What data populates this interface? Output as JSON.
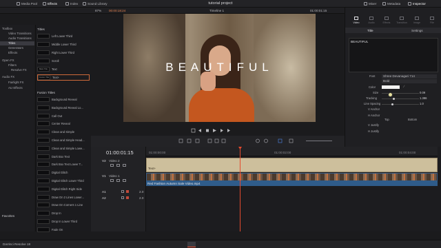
{
  "topbar": {
    "title": "tutorial project",
    "tabs_left": [
      "Media Pool",
      "Effects",
      "Index",
      "Sound Library"
    ],
    "tabs_right": [
      "Mixer",
      "Metadata",
      "Inspector"
    ]
  },
  "viewer": {
    "zoom": "87%",
    "timecode_in": "00:00:18:24",
    "timeline_name": "Timeline 1",
    "timecode": "01:00:01:15",
    "overlay_text": "BEAUTIFUL"
  },
  "toolbox": {
    "items": [
      "Toolbox",
      "Video Transitions",
      "Audio Transitions",
      "Titles",
      "Generators",
      "Effects",
      "Open FX",
      "Filters",
      "Resolve FX",
      "Audio FX",
      "Fairlight FX",
      "AU Effects"
    ],
    "favorites_label": "Favorites"
  },
  "effects": {
    "titles_header": "Titles",
    "titles": [
      {
        "name": "Left Lower Third",
        "thumb": ""
      },
      {
        "name": "Middle Lower Third",
        "thumb": ""
      },
      {
        "name": "Right Lower Third",
        "thumb": ""
      },
      {
        "name": "Scroll",
        "thumb": ""
      },
      {
        "name": "Text",
        "thumb": "Basic Title"
      },
      {
        "name": "Text+",
        "thumb": "Custom Title"
      }
    ],
    "fusion_header": "Fusion Titles",
    "fusion_titles": [
      "Background Reveal",
      "Background Reveal Lo...",
      "Call Out",
      "Center Reveal",
      "Clean and Simple",
      "Clean and Simple Head...",
      "Clean and Simple Lowe...",
      "Dark Box Text",
      "Dark Box Text Lower T...",
      "Digital Glitch",
      "Digital Glitch Lower Third",
      "Digital Glitch Right Side",
      "Draw On 2 Lines Lower...",
      "Draw On Corners 1 Line",
      "Drop In",
      "Drop In Lower Third",
      "Fade On"
    ]
  },
  "inspector": {
    "header": "Fusion Title - Text+",
    "tabs": [
      "Video",
      "Audio",
      "Effects",
      "Transition",
      "Image",
      "File"
    ],
    "subtabs": [
      "Title",
      "Settings"
    ],
    "text_value": "BEAUTIFUL",
    "font_label": "Font",
    "font_value": "Shree Devanagari 714",
    "style_value": "Bold",
    "color_label": "Color",
    "size_label": "Size",
    "size_value": "0.09",
    "tracking_label": "Tracking",
    "tracking_value": "1.386",
    "line_spacing_label": "Line Spacing",
    "line_spacing_value": "1.0",
    "v_anchor_label": "V Anchor",
    "h_anchor_label": "H Anchor",
    "top_label": "Top",
    "bottom_label": "Bottom",
    "v_justify_label": "V Justify",
    "h_justify_label": "H Justify"
  },
  "timeline": {
    "timecode": "01:00:01:15",
    "ruler_labels": [
      "01:00:00:00",
      "01:00:02:00",
      "01:00:04:00"
    ],
    "tracks": [
      {
        "id": "V2",
        "name": "Video 2"
      },
      {
        "id": "V1",
        "name": "Video 1"
      },
      {
        "id": "A1",
        "name": "",
        "level": "2.0"
      },
      {
        "id": "A2",
        "name": "",
        "level": "2.0"
      }
    ],
    "title_clip_label": "Text+",
    "video_clip_label": "Red Fashion Autumn Sale Video.mp4"
  },
  "bottombar": {
    "app_name": "DaVinci Resolve 18"
  },
  "colors": {
    "accent": "#e64a2e",
    "selection": "#d06a3a",
    "title_clip": "#cdbf9c",
    "video_clip_border": "#3a5f8a"
  }
}
